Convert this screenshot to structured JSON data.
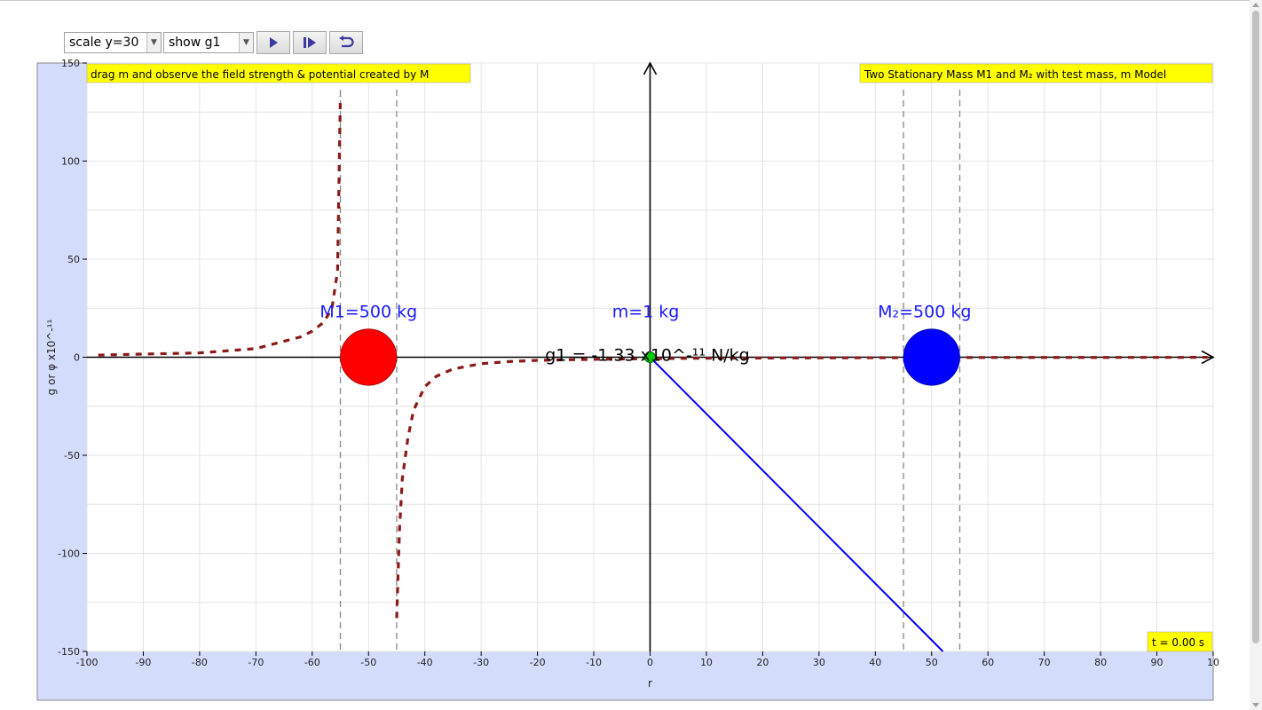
{
  "toolbar": {
    "scale_select": "scale y=30",
    "show_select": "show g1",
    "play_icon": "play-icon",
    "step_icon": "step-forward-icon",
    "reset_icon": "reset-icon"
  },
  "banner_left": "drag m and observe the field strength & potential created by M",
  "banner_right": "Two Stationary Mass M1 and M₂ with test mass, m Model",
  "time_label": "t = 0.00 s",
  "masses": {
    "m1_label": "M1=500 kg",
    "m2_label": "M₂=500 kg",
    "m_label": "m=1 kg",
    "g_readout": "g1 = -1.33 x10^-¹¹ N/kg",
    "m1_x": -50,
    "m2_x": 50,
    "m_x": 0,
    "radius_units": 5,
    "m1_color": "#ff0000",
    "m2_color": "#0000ff",
    "m_color": "#00cc00"
  },
  "colors": {
    "panel_bg": "#d4dcfb",
    "banner_bg": "#ffff00",
    "curve": "#8b1a1a",
    "vector": "#0000ff",
    "grid": "#e4e4e4",
    "label_blue": "#1a1aff"
  },
  "chart_data": {
    "type": "line",
    "xlabel": "r",
    "ylabel": "g or φ x10^-¹¹",
    "xlim": [
      -100,
      100
    ],
    "ylim": [
      -150,
      150
    ],
    "x_ticks": [
      -100,
      -90,
      -80,
      -70,
      -60,
      -50,
      -40,
      -30,
      -20,
      -10,
      0,
      10,
      20,
      30,
      40,
      50,
      60,
      70,
      80,
      90,
      100
    ],
    "y_ticks": [
      -150,
      -100,
      -50,
      0,
      50,
      100,
      150
    ],
    "x_tick_labels": [
      "-100",
      "-90",
      "-80",
      "-70",
      "-60",
      "-50",
      "-40",
      "-30",
      "-20",
      "-10",
      "0",
      "10",
      "20",
      "30",
      "40",
      "50",
      "60",
      "70",
      "80",
      "90",
      "10"
    ],
    "y_tick_labels": [
      "-150",
      "-100",
      "-50",
      "0",
      "50",
      "100",
      "150"
    ],
    "grid": true,
    "series": [
      {
        "x": [
          -98,
          -90,
          -80,
          -70,
          -62,
          -60,
          -58,
          -56.5,
          -55.5,
          -55
        ],
        "y": [
          1.1,
          1.6,
          2.2,
          4.4,
          10.4,
          13.3,
          17.7,
          24.8,
          44,
          133
        ]
      },
      {
        "x": [
          -45,
          -44.5,
          -44,
          -43,
          -42,
          -40,
          -38,
          -35,
          -30,
          -25,
          -20,
          -15,
          -10,
          -5,
          0,
          10,
          20,
          30,
          40,
          45,
          55,
          60,
          70,
          80,
          90,
          99
        ],
        "y": [
          -133,
          -88,
          -62,
          -41,
          -27,
          -15,
          -9.8,
          -6,
          -3.3,
          -2.2,
          -1.6,
          -1.3,
          -1.1,
          -0.9,
          -0.7,
          -0.5,
          -0.4,
          -0.3,
          -0.25,
          -0.2,
          -0.15,
          -0.13,
          -0.11,
          -0.1,
          -0.08,
          -0.07
        ]
      }
    ],
    "dashed_bounds_x": [
      -55,
      -45,
      45,
      55
    ]
  }
}
